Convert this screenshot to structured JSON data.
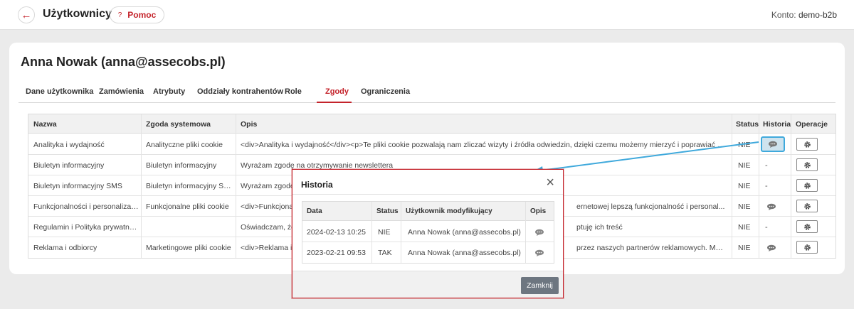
{
  "header": {
    "title": "Użytkownicy",
    "help_label": "Pomoc",
    "account_label": "Konto:",
    "account_value": "demo-b2b"
  },
  "user": {
    "name": "Anna Nowak (anna@assecobs.pl)"
  },
  "tabs": [
    {
      "label": "Dane użytkownika"
    },
    {
      "label": "Zamówienia"
    },
    {
      "label": "Atrybuty"
    },
    {
      "label": "Oddziały kontrahentów"
    },
    {
      "label": "Role"
    },
    {
      "label": "Zgody",
      "active": true
    },
    {
      "label": "Ograniczenia"
    }
  ],
  "table": {
    "columns": [
      "Nazwa",
      "Zgoda systemowa",
      "Opis",
      "Status",
      "Historia",
      "Operacje"
    ],
    "rows": [
      {
        "name": "Analityka i wydajność",
        "system": "Analityczne pliki cookie",
        "desc": "<div>Analityka i wydajność</div><p>Te pliki cookie pozwalają nam zliczać wizyty i źródła odwiedzin, dzięki czemu możemy mierzyć i poprawiać wydajno...",
        "status": "NIE",
        "history": "icon"
      },
      {
        "name": "Biuletyn informacyjny",
        "system": "Biuletyn informacyjny",
        "desc": "Wyrażam zgodę na otrzymywanie newslettera",
        "status": "NIE",
        "history": "-"
      },
      {
        "name": "Biuletyn informacyjny SMS",
        "system": "Biuletyn informacyjny SMS",
        "desc": "Wyrażam zgodę n",
        "status": "NIE",
        "history": "-"
      },
      {
        "name": "Funkcjonalności i personalizacja",
        "system": "Funkcjonalne pliki cookie",
        "desc": "<div>Funkcjonaln",
        "desc_tail": "ernetowej lepszą funkcjonalność i personal...",
        "status": "NIE",
        "history": "icon"
      },
      {
        "name": "Regulamin i Polityka prywatności",
        "system": "",
        "desc": "Oświadczam, że z",
        "desc_tail": "ptuję ich treść",
        "status": "NIE",
        "history": "-"
      },
      {
        "name": "Reklama i odbiorcy",
        "system": "Marketingowe pliki cookie",
        "desc": "<div>Reklama i o",
        "desc_tail": "przez naszych partnerów reklamowych. Mogą by...",
        "status": "NIE",
        "history": "icon"
      }
    ]
  },
  "modal": {
    "title": "Historia",
    "columns": [
      "Data",
      "Status",
      "Użytkownik modyfikujący",
      "Opis"
    ],
    "rows": [
      {
        "date": "2024-02-13 10:25",
        "status": "NIE",
        "user": "Anna Nowak (anna@assecobs.pl)"
      },
      {
        "date": "2023-02-21 09:53",
        "status": "TAK",
        "user": "Anna Nowak (anna@assecobs.pl)"
      }
    ],
    "close_label": "Zamknij"
  },
  "colors": {
    "accent": "#c4232b",
    "highlight": "#3fa9dc"
  },
  "icons": [
    "back-arrow-icon",
    "question-icon",
    "chat-bubble-icon",
    "gear-icon",
    "close-icon"
  ]
}
